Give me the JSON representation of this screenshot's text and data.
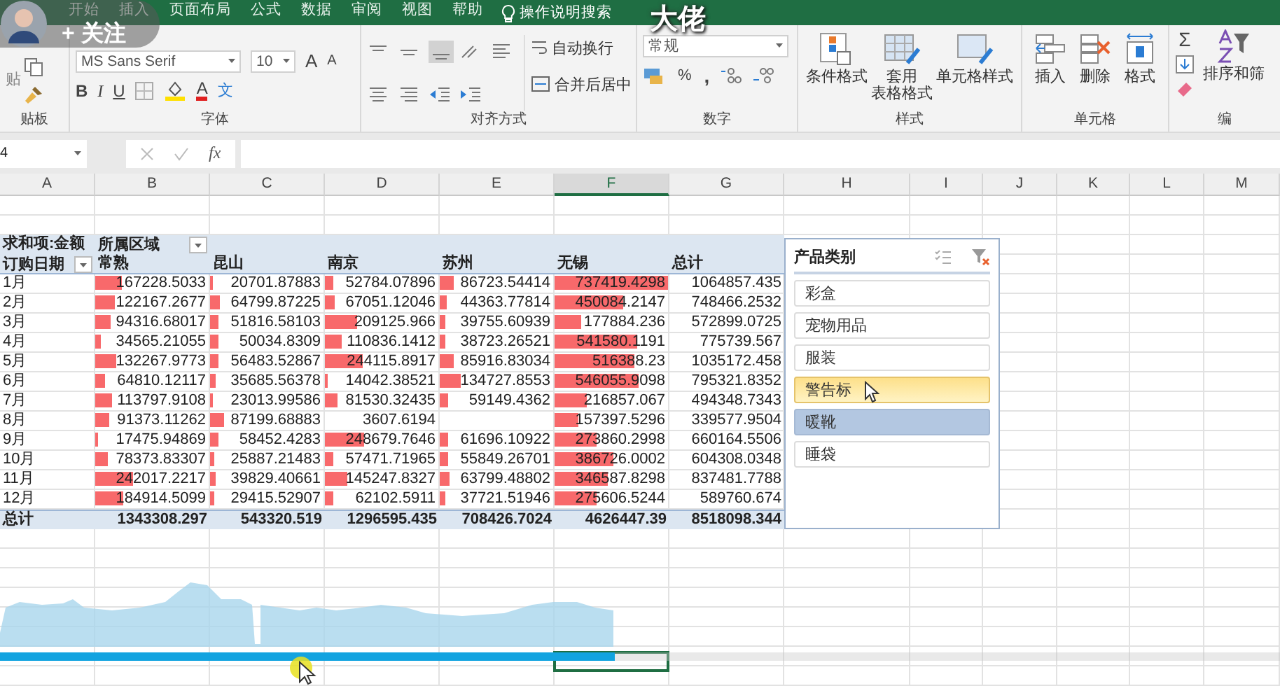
{
  "ribbon_tabs": [
    {
      "label": "开始"
    },
    {
      "label": "插入"
    },
    {
      "label": "页面布局"
    },
    {
      "label": "公式"
    },
    {
      "label": "数据"
    },
    {
      "label": "审阅"
    },
    {
      "label": "视图"
    },
    {
      "label": "帮助"
    }
  ],
  "tell_me": "操作说明搜索",
  "ribbon": {
    "clipboard": {
      "label": "贴板",
      "paste": "贴"
    },
    "font": {
      "label": "字体",
      "font_name": "MS Sans Serif",
      "font_size": "10",
      "grow": "A",
      "shrink": "A",
      "bold": "B",
      "italic": "I",
      "underline": "U",
      "font_color": "A",
      "phonetic": "文"
    },
    "alignment": {
      "label": "对齐方式",
      "wrap": "自动换行",
      "merge": "合并后居中"
    },
    "number": {
      "label": "数字",
      "format": "常规",
      "percent": "%",
      "comma": ","
    },
    "styles": {
      "label": "样式",
      "buttons": [
        {
          "lines": [
            "条件格式"
          ]
        },
        {
          "lines": [
            "套用",
            "表格格式"
          ]
        },
        {
          "lines": [
            "单元格样式"
          ]
        }
      ]
    },
    "cells": {
      "label": "单元格",
      "buttons": [
        "插入",
        "删除",
        "格式"
      ]
    },
    "editing": {
      "label": "编",
      "sum": "Σ",
      "sort": "排序和筛"
    }
  },
  "formula_bar": {
    "name_box": "4",
    "fx": "fx"
  },
  "columns": [
    {
      "label": "A",
      "selected": false
    },
    {
      "label": "B",
      "selected": false
    },
    {
      "label": "C",
      "selected": false
    },
    {
      "label": "D",
      "selected": false
    },
    {
      "label": "E",
      "selected": false
    },
    {
      "label": "F",
      "selected": true
    },
    {
      "label": "G",
      "selected": false
    },
    {
      "label": "H",
      "selected": false
    },
    {
      "label": "I",
      "selected": false
    },
    {
      "label": "J",
      "selected": false
    },
    {
      "label": "K",
      "selected": false
    },
    {
      "label": "L",
      "selected": false
    },
    {
      "label": "M",
      "selected": false
    }
  ],
  "pivot": {
    "value_field": "求和项:金额",
    "column_field": "所属区域",
    "row_field": "订购日期",
    "headers": [
      "常熟",
      "昆山",
      "南京",
      "苏州",
      "无锡",
      "总计"
    ],
    "rows": [
      {
        "label": "1月",
        "cells": [
          {
            "text": "167228.5033",
            "level": 0.23
          },
          {
            "text": "20701.87883",
            "level": 0.03
          },
          {
            "text": "52784.07896",
            "level": 0.07
          },
          {
            "text": "86723.54414",
            "level": 0.12
          },
          {
            "text": "737419.4298",
            "level": 1
          }
        ],
        "total": "1064857.435"
      },
      {
        "label": "2月",
        "cells": [
          {
            "text": "122167.2677",
            "level": 0.17
          },
          {
            "text": "64799.87225",
            "level": 0.09
          },
          {
            "text": "67051.12046",
            "level": 0.09
          },
          {
            "text": "44363.77814",
            "level": 0.06
          },
          {
            "text": "450084.2147",
            "level": 0.61
          }
        ],
        "total": "748466.2532"
      },
      {
        "label": "3月",
        "cells": [
          {
            "text": "94316.68017",
            "level": 0.13
          },
          {
            "text": "51816.58103",
            "level": 0.07
          },
          {
            "text": "209125.966",
            "level": 0.28
          },
          {
            "text": "39755.60939",
            "level": 0.05
          },
          {
            "text": "177884.236",
            "level": 0.24
          }
        ],
        "total": "572899.0725"
      },
      {
        "label": "4月",
        "cells": [
          {
            "text": "34565.21055",
            "level": 0.05
          },
          {
            "text": "50034.8309",
            "level": 0.07
          },
          {
            "text": "110836.1412",
            "level": 0.15
          },
          {
            "text": "38723.26521",
            "level": 0.05
          },
          {
            "text": "541580.1191",
            "level": 0.73
          }
        ],
        "total": "775739.567"
      },
      {
        "label": "5月",
        "cells": [
          {
            "text": "132267.9773",
            "level": 0.18
          },
          {
            "text": "56483.52867",
            "level": 0.08
          },
          {
            "text": "244115.8917",
            "level": 0.33
          },
          {
            "text": "85916.83034",
            "level": 0.12
          },
          {
            "text": "516388.23",
            "level": 0.7
          }
        ],
        "total": "1035172.458"
      },
      {
        "label": "6月",
        "cells": [
          {
            "text": "64810.12117",
            "level": 0.09
          },
          {
            "text": "35685.56378",
            "level": 0.05
          },
          {
            "text": "14042.38521",
            "level": 0.02
          },
          {
            "text": "134727.8553",
            "level": 0.18
          },
          {
            "text": "546055.9098",
            "level": 0.74
          }
        ],
        "total": "795321.8352"
      },
      {
        "label": "7月",
        "cells": [
          {
            "text": "113797.9108",
            "level": 0.15
          },
          {
            "text": "23013.99586",
            "level": 0.03
          },
          {
            "text": "81530.32435",
            "level": 0.11
          },
          {
            "text": "59149.4362",
            "level": 0.08
          },
          {
            "text": "216857.067",
            "level": 0.29
          }
        ],
        "total": "494348.7343"
      },
      {
        "label": "8月",
        "cells": [
          {
            "text": "91373.11262",
            "level": 0.12
          },
          {
            "text": "87199.68883",
            "level": 0.12
          },
          {
            "text": "3607.6194"
          },
          null,
          {
            "text": "157397.5296",
            "level": 0.21
          }
        ],
        "total": "339577.9504"
      },
      {
        "label": "9月",
        "cells": [
          {
            "text": "17475.94869",
            "level": 0.02
          },
          {
            "text": "58452.4283",
            "level": 0.08
          },
          {
            "text": "248679.7646",
            "level": 0.34
          },
          {
            "text": "61696.10922",
            "level": 0.08
          },
          {
            "text": "273860.2998",
            "level": 0.37
          }
        ],
        "total": "660164.5506"
      },
      {
        "label": "10月",
        "cells": [
          {
            "text": "78373.83307",
            "level": 0.11
          },
          {
            "text": "25887.21483",
            "level": 0.04
          },
          {
            "text": "57471.71965",
            "level": 0.08
          },
          {
            "text": "55849.26701",
            "level": 0.08
          },
          {
            "text": "386726.0002",
            "level": 0.52
          }
        ],
        "total": "604308.0348"
      },
      {
        "label": "11月",
        "cells": [
          {
            "text": "242017.2217",
            "level": 0.33
          },
          {
            "text": "39829.40661",
            "level": 0.05
          },
          {
            "text": "145247.8327",
            "level": 0.2
          },
          {
            "text": "63799.48802",
            "level": 0.09
          },
          {
            "text": "346587.8298",
            "level": 0.47
          }
        ],
        "total": "837481.7788"
      },
      {
        "label": "12月",
        "cells": [
          {
            "text": "184914.5099",
            "level": 0.25
          },
          {
            "text": "29415.52907",
            "level": 0.04
          },
          {
            "text": "62102.5911",
            "level": 0.08
          },
          {
            "text": "37721.51946",
            "level": 0.05
          },
          {
            "text": "275606.5244",
            "level": 0.37
          }
        ],
        "total": "589760.674"
      }
    ],
    "grand_total": {
      "label": "总计",
      "values": [
        "1343308.297",
        "543320.519",
        "1296595.435",
        "708426.7024",
        "4626447.39",
        "8518098.344"
      ]
    }
  },
  "slicer": {
    "title": "产品类别",
    "items": [
      {
        "label": "彩盒",
        "selected": false,
        "hovered": false
      },
      {
        "label": "宠物用品",
        "selected": false,
        "hovered": false
      },
      {
        "label": "服装",
        "selected": false,
        "hovered": false
      },
      {
        "label": "警告标",
        "selected": false,
        "hovered": true
      },
      {
        "label": "暖靴",
        "selected": true,
        "hovered": false
      },
      {
        "label": "睡袋",
        "selected": false,
        "hovered": false
      }
    ]
  },
  "video_overlay": {
    "follow_button": "+ 关注",
    "caption": "大佬",
    "progress": {
      "level": 0.48
    }
  }
}
